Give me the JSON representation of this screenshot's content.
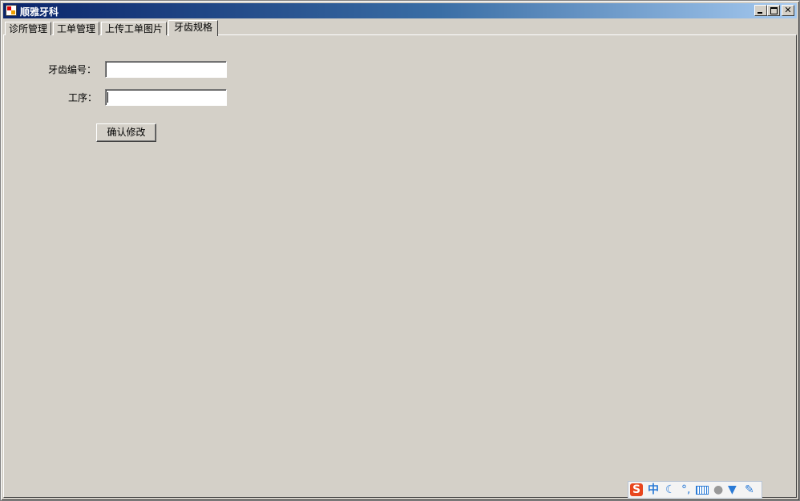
{
  "window": {
    "title": "顺雅牙科"
  },
  "tabs": [
    {
      "label": "诊所管理"
    },
    {
      "label": "工单管理"
    },
    {
      "label": "上传工单图片"
    },
    {
      "label": "牙齿规格",
      "active": true
    }
  ],
  "form": {
    "tooth_number_label": "牙齿编号：",
    "tooth_number_value": "",
    "process_label": "工序：",
    "process_value": "",
    "confirm_button": "确认修改"
  },
  "ime_toolbar": {
    "logo": "S",
    "mode": "中",
    "icons": [
      "sogou-logo-icon",
      "chinese-mode-icon",
      "moon-icon",
      "punctuation-icon",
      "keyboard-icon",
      "user-icon",
      "skin-icon",
      "settings-wrench-icon"
    ]
  }
}
